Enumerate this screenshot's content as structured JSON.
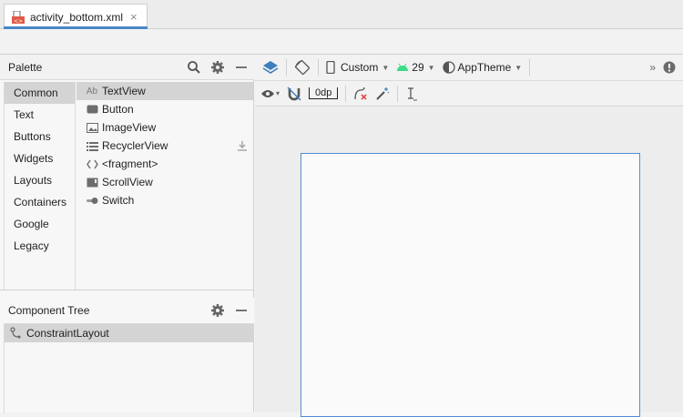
{
  "tab": {
    "label": "activity_bottom.xml",
    "close_glyph": "×"
  },
  "palette": {
    "title": "Palette",
    "categories": [
      "Common",
      "Text",
      "Buttons",
      "Widgets",
      "Layouts",
      "Containers",
      "Google",
      "Legacy"
    ],
    "items": [
      {
        "label": "TextView",
        "icon": "textview-icon",
        "icon_text": "Ab"
      },
      {
        "label": "Button",
        "icon": "button-icon"
      },
      {
        "label": "ImageView",
        "icon": "imageview-icon"
      },
      {
        "label": "RecyclerView",
        "icon": "recyclerview-icon"
      },
      {
        "label": "<fragment>",
        "icon": "fragment-icon"
      },
      {
        "label": "ScrollView",
        "icon": "scrollview-icon"
      },
      {
        "label": "Switch",
        "icon": "switch-icon"
      }
    ]
  },
  "component_tree": {
    "title": "Component Tree",
    "root": "ConstraintLayout"
  },
  "design_toolbar": {
    "device": "Custom",
    "api": "29",
    "theme": "AppTheme",
    "margin": "0dp",
    "more": "»"
  },
  "colors": {
    "accent": "#4a88c7",
    "android_green": "#3ddc84",
    "selection": "#d4d4d4",
    "blueprint_border": "#4f8fd0"
  }
}
